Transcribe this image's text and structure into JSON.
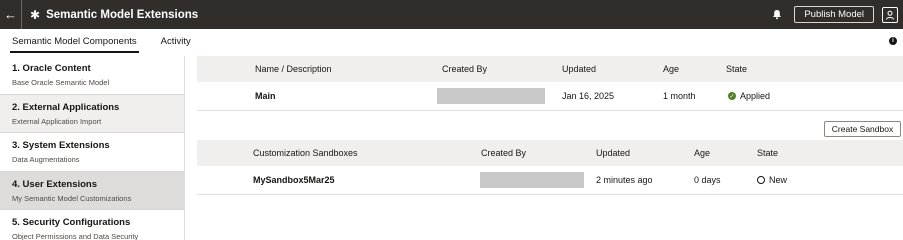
{
  "app": {
    "title": "Semantic Model Extensions"
  },
  "toolbar": {
    "publish_label": "Publish Model"
  },
  "tabs": [
    {
      "label": "Semantic Model Components"
    },
    {
      "label": "Activity"
    }
  ],
  "sidebar": {
    "items": [
      {
        "title": "1. Oracle Content",
        "subtitle": "Base Oracle Semantic Model"
      },
      {
        "title": "2. External Applications",
        "subtitle": "External Application Import"
      },
      {
        "title": "3. System Extensions",
        "subtitle": "Data Augmentations"
      },
      {
        "title": "4. User Extensions",
        "subtitle": "My Semantic Model Customizations"
      },
      {
        "title": "5. Security Configurations",
        "subtitle": "Object Permissions and Data Security"
      }
    ]
  },
  "main_table": {
    "headers": {
      "name": "Name / Description",
      "created_by": "Created By",
      "updated": "Updated",
      "age": "Age",
      "state": "State"
    },
    "rows": [
      {
        "name": "Main",
        "updated": "Jan 16, 2025",
        "age": "1 month",
        "state": "Applied"
      }
    ]
  },
  "create_sandbox_label": "Create Sandbox",
  "sandbox_table": {
    "headers": {
      "name": "Customization Sandboxes",
      "created_by": "Created By",
      "updated": "Updated",
      "age": "Age",
      "state": "State"
    },
    "rows": [
      {
        "name": "MySandbox5Mar25",
        "updated": "2 minutes ago",
        "age": "0 days",
        "state": "New"
      }
    ]
  },
  "colors": {
    "topbar": "#312d2a",
    "applied": "#508223",
    "selected_item": "#dedcda"
  },
  "icons": {
    "back": "back-arrow-icon",
    "app": "model-icon",
    "notifications": "bell-icon",
    "user": "user-icon",
    "info": "info-icon"
  }
}
